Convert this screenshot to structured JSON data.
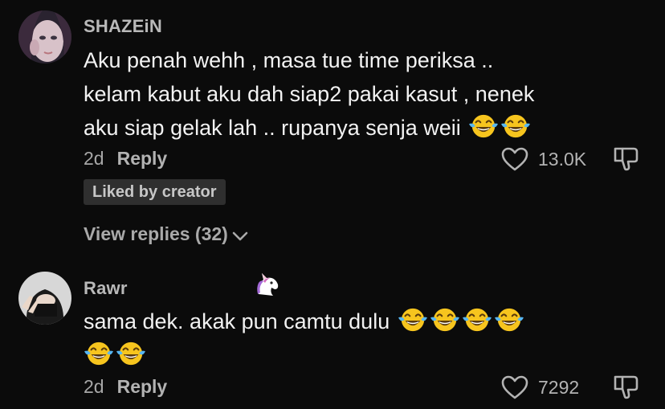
{
  "comments": [
    {
      "username": "SHAZEiN",
      "text_lines": [
        "Aku penah wehh , masa tue time periksa ..",
        "kelam kabut aku dah siap2 pakai kasut , nenek",
        "aku siap gelak lah .. rupanya senja weii"
      ],
      "trailing_emoji": [
        "face-with-tears-of-joy",
        "face-with-tears-of-joy"
      ],
      "age": "2d",
      "reply_label": "Reply",
      "like_count": "13.0K",
      "badge": "Liked by creator",
      "view_replies": "View replies (32)"
    },
    {
      "username": "Rawr",
      "name_emoji": "unicorn",
      "text_lines": [
        "sama dek. akak pun camtu dulu"
      ],
      "trailing_emoji": [
        "face-with-tears-of-joy",
        "face-with-tears-of-joy",
        "face-with-tears-of-joy",
        "face-with-tears-of-joy"
      ],
      "second_line_emoji": [
        "face-with-tears-of-joy",
        "face-with-tears-of-joy"
      ],
      "age": "2d",
      "reply_label": "Reply",
      "like_count": "7292"
    }
  ],
  "icons": {
    "like": "heart-outline-icon",
    "dislike": "thumbs-down-icon",
    "expand": "chevron-down-icon"
  },
  "colors": {
    "background": "#0b0b0b",
    "username": "#b9b9b9",
    "text": "#f2f2f2",
    "muted": "#a7a7a7",
    "badge_bg": "#2f2f2f"
  }
}
